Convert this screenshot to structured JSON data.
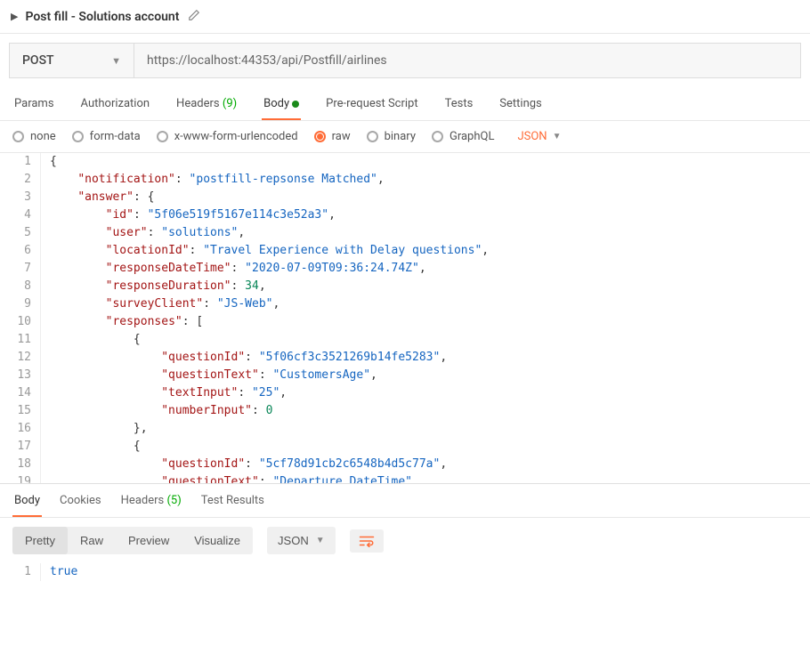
{
  "header": {
    "title": "Post fill - Solutions account"
  },
  "request": {
    "method": "POST",
    "url": "https://localhost:44353/api/Postfill/airlines"
  },
  "tabs": [
    {
      "label": "Params"
    },
    {
      "label": "Authorization"
    },
    {
      "label": "Headers",
      "count": "(9)"
    },
    {
      "label": "Body",
      "active": true
    },
    {
      "label": "Pre-request Script"
    },
    {
      "label": "Tests"
    },
    {
      "label": "Settings"
    }
  ],
  "bodyTypes": [
    {
      "label": "none"
    },
    {
      "label": "form-data"
    },
    {
      "label": "x-www-form-urlencoded"
    },
    {
      "label": "raw",
      "selected": true
    },
    {
      "label": "binary"
    },
    {
      "label": "GraphQL"
    }
  ],
  "rawTypeLabel": "JSON",
  "editor": {
    "lines": [
      {
        "n": 1,
        "indent": 0,
        "tokens": [
          {
            "t": "punct",
            "v": "{"
          }
        ]
      },
      {
        "n": 2,
        "indent": 1,
        "tokens": [
          {
            "t": "key",
            "v": "\"notification\""
          },
          {
            "t": "punct",
            "v": ": "
          },
          {
            "t": "str",
            "v": "\"postfill-repsonse Matched\""
          },
          {
            "t": "punct",
            "v": ","
          }
        ]
      },
      {
        "n": 3,
        "indent": 1,
        "tokens": [
          {
            "t": "key",
            "v": "\"answer\""
          },
          {
            "t": "punct",
            "v": ": {"
          }
        ]
      },
      {
        "n": 4,
        "indent": 2,
        "tokens": [
          {
            "t": "key",
            "v": "\"id\""
          },
          {
            "t": "punct",
            "v": ": "
          },
          {
            "t": "str",
            "v": "\"5f06e519f5167e114c3e52a3\""
          },
          {
            "t": "punct",
            "v": ","
          }
        ]
      },
      {
        "n": 5,
        "indent": 2,
        "tokens": [
          {
            "t": "key",
            "v": "\"user\""
          },
          {
            "t": "punct",
            "v": ": "
          },
          {
            "t": "str",
            "v": "\"solutions\""
          },
          {
            "t": "punct",
            "v": ","
          }
        ]
      },
      {
        "n": 6,
        "indent": 2,
        "tokens": [
          {
            "t": "key",
            "v": "\"locationId\""
          },
          {
            "t": "punct",
            "v": ": "
          },
          {
            "t": "str",
            "v": "\"Travel Experience with Delay questions\""
          },
          {
            "t": "punct",
            "v": ","
          }
        ]
      },
      {
        "n": 7,
        "indent": 2,
        "tokens": [
          {
            "t": "key",
            "v": "\"responseDateTime\""
          },
          {
            "t": "punct",
            "v": ": "
          },
          {
            "t": "str",
            "v": "\"2020-07-09T09:36:24.74Z\""
          },
          {
            "t": "punct",
            "v": ","
          }
        ]
      },
      {
        "n": 8,
        "indent": 2,
        "tokens": [
          {
            "t": "key",
            "v": "\"responseDuration\""
          },
          {
            "t": "punct",
            "v": ": "
          },
          {
            "t": "num",
            "v": "34"
          },
          {
            "t": "punct",
            "v": ","
          }
        ]
      },
      {
        "n": 9,
        "indent": 2,
        "tokens": [
          {
            "t": "key",
            "v": "\"surveyClient\""
          },
          {
            "t": "punct",
            "v": ": "
          },
          {
            "t": "str",
            "v": "\"JS-Web\""
          },
          {
            "t": "punct",
            "v": ","
          }
        ]
      },
      {
        "n": 10,
        "indent": 2,
        "tokens": [
          {
            "t": "key",
            "v": "\"responses\""
          },
          {
            "t": "punct",
            "v": ": ["
          }
        ]
      },
      {
        "n": 11,
        "indent": 3,
        "tokens": [
          {
            "t": "punct",
            "v": "{"
          }
        ]
      },
      {
        "n": 12,
        "indent": 4,
        "tokens": [
          {
            "t": "key",
            "v": "\"questionId\""
          },
          {
            "t": "punct",
            "v": ": "
          },
          {
            "t": "str",
            "v": "\"5f06cf3c3521269b14fe5283\""
          },
          {
            "t": "punct",
            "v": ","
          }
        ]
      },
      {
        "n": 13,
        "indent": 4,
        "tokens": [
          {
            "t": "key",
            "v": "\"questionText\""
          },
          {
            "t": "punct",
            "v": ": "
          },
          {
            "t": "str",
            "v": "\"CustomersAge\""
          },
          {
            "t": "punct",
            "v": ","
          }
        ]
      },
      {
        "n": 14,
        "indent": 4,
        "tokens": [
          {
            "t": "key",
            "v": "\"textInput\""
          },
          {
            "t": "punct",
            "v": ": "
          },
          {
            "t": "str",
            "v": "\"25\""
          },
          {
            "t": "punct",
            "v": ","
          }
        ]
      },
      {
        "n": 15,
        "indent": 4,
        "tokens": [
          {
            "t": "key",
            "v": "\"numberInput\""
          },
          {
            "t": "punct",
            "v": ": "
          },
          {
            "t": "num",
            "v": "0"
          }
        ]
      },
      {
        "n": 16,
        "indent": 3,
        "tokens": [
          {
            "t": "punct",
            "v": "},"
          }
        ]
      },
      {
        "n": 17,
        "indent": 3,
        "tokens": [
          {
            "t": "punct",
            "v": "{"
          }
        ]
      },
      {
        "n": 18,
        "indent": 4,
        "tokens": [
          {
            "t": "key",
            "v": "\"questionId\""
          },
          {
            "t": "punct",
            "v": ": "
          },
          {
            "t": "str",
            "v": "\"5cf78d91cb2c6548b4d5c77a\""
          },
          {
            "t": "punct",
            "v": ","
          }
        ]
      },
      {
        "n": 19,
        "indent": 4,
        "tokens": [
          {
            "t": "key",
            "v": "\"questionText\""
          },
          {
            "t": "punct",
            "v": ": "
          },
          {
            "t": "str",
            "v": "\"Departure DateTime\""
          },
          {
            "t": "punct",
            "v": ","
          }
        ]
      }
    ]
  },
  "response": {
    "tabs": [
      {
        "label": "Body",
        "active": true
      },
      {
        "label": "Cookies"
      },
      {
        "label": "Headers",
        "count": "(5)"
      },
      {
        "label": "Test Results"
      }
    ],
    "viewModes": [
      {
        "label": "Pretty",
        "active": true
      },
      {
        "label": "Raw"
      },
      {
        "label": "Preview"
      },
      {
        "label": "Visualize"
      }
    ],
    "typeLabel": "JSON",
    "bodyLine": {
      "n": 1,
      "value": "true"
    }
  }
}
